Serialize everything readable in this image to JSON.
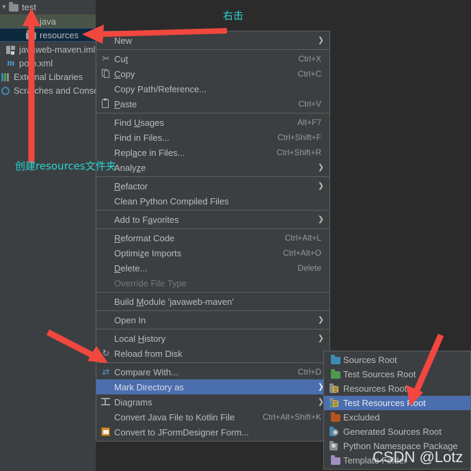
{
  "tree": {
    "rows": [
      {
        "label": "test",
        "icon": "folder-gray-icon",
        "indent": 16,
        "chevron": "v",
        "state": "normal"
      },
      {
        "label": "java",
        "icon": "folder-source-icon",
        "indent": 38,
        "chevron": "",
        "state": "hover"
      },
      {
        "label": "resources",
        "icon": "folder-plain-icon",
        "indent": 38,
        "chevron": "",
        "state": "selected"
      },
      {
        "label": "javaweb-maven.iml",
        "icon": "iml-file-icon",
        "indent": 8,
        "chevron": "",
        "state": "normal"
      },
      {
        "label": "pom.xml",
        "icon": "maven-pom-icon",
        "indent": 8,
        "chevron": "",
        "state": "normal"
      },
      {
        "label": "External Libraries",
        "icon": "libraries-icon",
        "indent": 0,
        "chevron": "",
        "state": "normal"
      },
      {
        "label": "Scratches and Consoles",
        "icon": "scratches-icon",
        "indent": 0,
        "chevron": "",
        "state": "normal"
      }
    ]
  },
  "context_menu": {
    "items": [
      {
        "type": "item",
        "label": "New",
        "pre": "",
        "uk": "",
        "post": "",
        "shortcut": "",
        "icon": "",
        "arrow": true
      },
      {
        "type": "sep"
      },
      {
        "type": "item",
        "label": "Cut",
        "pre": "Cu",
        "uk": "t",
        "post": "",
        "shortcut": "Ctrl+X",
        "icon": "scissors-icon",
        "arrow": false
      },
      {
        "type": "item",
        "label": "Copy",
        "pre": "",
        "uk": "C",
        "post": "opy",
        "shortcut": "Ctrl+C",
        "icon": "copy-icon",
        "arrow": false
      },
      {
        "type": "item",
        "label": "Copy Path/Reference...",
        "pre": "Copy Path/Reference...",
        "uk": "",
        "post": "",
        "shortcut": "",
        "icon": "",
        "arrow": false
      },
      {
        "type": "item",
        "label": "Paste",
        "pre": "",
        "uk": "P",
        "post": "aste",
        "shortcut": "Ctrl+V",
        "icon": "paste-icon",
        "arrow": false
      },
      {
        "type": "sep"
      },
      {
        "type": "item",
        "label": "Find Usages",
        "pre": "Find ",
        "uk": "U",
        "post": "sages",
        "shortcut": "Alt+F7",
        "icon": "",
        "arrow": false
      },
      {
        "type": "item",
        "label": "Find in Files...",
        "pre": "Find in Files...",
        "uk": "",
        "post": "",
        "shortcut": "Ctrl+Shift+F",
        "icon": "",
        "arrow": false
      },
      {
        "type": "item",
        "label": "Replace in Files...",
        "pre": "Repl",
        "uk": "a",
        "post": "ce in Files...",
        "shortcut": "Ctrl+Shift+R",
        "icon": "",
        "arrow": false
      },
      {
        "type": "item",
        "label": "Analyze",
        "pre": "Analy",
        "uk": "z",
        "post": "e",
        "shortcut": "",
        "icon": "",
        "arrow": true
      },
      {
        "type": "sep"
      },
      {
        "type": "item",
        "label": "Refactor",
        "pre": "",
        "uk": "R",
        "post": "efactor",
        "shortcut": "",
        "icon": "",
        "arrow": true
      },
      {
        "type": "item",
        "label": "Clean Python Compiled Files",
        "pre": "Clean Python Compiled Files",
        "uk": "",
        "post": "",
        "shortcut": "",
        "icon": "",
        "arrow": false
      },
      {
        "type": "sep"
      },
      {
        "type": "item",
        "label": "Add to Favorites",
        "pre": "Add to F",
        "uk": "a",
        "post": "vorites",
        "shortcut": "",
        "icon": "",
        "arrow": true
      },
      {
        "type": "sep"
      },
      {
        "type": "item",
        "label": "Reformat Code",
        "pre": "",
        "uk": "R",
        "post": "eformat Code",
        "shortcut": "Ctrl+Alt+L",
        "icon": "",
        "arrow": false
      },
      {
        "type": "item",
        "label": "Optimize Imports",
        "pre": "Optimi",
        "uk": "z",
        "post": "e Imports",
        "shortcut": "Ctrl+Alt+O",
        "icon": "",
        "arrow": false
      },
      {
        "type": "item",
        "label": "Delete...",
        "pre": "",
        "uk": "D",
        "post": "elete...",
        "shortcut": "Delete",
        "icon": "",
        "arrow": false
      },
      {
        "type": "item",
        "label": "Override File Type",
        "pre": "Override File Type",
        "uk": "",
        "post": "",
        "shortcut": "",
        "icon": "",
        "arrow": false,
        "disabled": true
      },
      {
        "type": "sep"
      },
      {
        "type": "item",
        "label": "Build Module 'javaweb-maven'",
        "pre": "Build ",
        "uk": "M",
        "post": "odule 'javaweb-maven'",
        "shortcut": "",
        "icon": "",
        "arrow": false
      },
      {
        "type": "sep"
      },
      {
        "type": "item",
        "label": "Open In",
        "pre": "Open In",
        "uk": "",
        "post": "",
        "shortcut": "",
        "icon": "",
        "arrow": true
      },
      {
        "type": "sep"
      },
      {
        "type": "item",
        "label": "Local History",
        "pre": "Local ",
        "uk": "H",
        "post": "istory",
        "shortcut": "",
        "icon": "",
        "arrow": true
      },
      {
        "type": "item",
        "label": "Reload from Disk",
        "pre": "Reload from Disk",
        "uk": "",
        "post": "",
        "shortcut": "",
        "icon": "reload-icon",
        "arrow": false
      },
      {
        "type": "sep"
      },
      {
        "type": "item",
        "label": "Compare With...",
        "pre": "Compare With...",
        "uk": "",
        "post": "",
        "shortcut": "Ctrl+D",
        "icon": "compare-icon",
        "arrow": false
      },
      {
        "type": "item",
        "label": "Mark Directory as",
        "pre": "Mark Directory as",
        "uk": "",
        "post": "",
        "shortcut": "",
        "icon": "",
        "arrow": true,
        "selected": true
      },
      {
        "type": "item",
        "label": "Diagrams",
        "pre": "Diagrams",
        "uk": "",
        "post": "",
        "shortcut": "",
        "icon": "diagrams-icon",
        "arrow": true
      },
      {
        "type": "item",
        "label": "Convert Java File to Kotlin File",
        "pre": "Convert Java File to Kotlin File",
        "uk": "",
        "post": "",
        "shortcut": "Ctrl+Alt+Shift+K",
        "icon": "",
        "arrow": false
      },
      {
        "type": "item",
        "label": "Convert to JFormDesigner Form...",
        "pre": "Convert to JFormDesigner Form...",
        "uk": "",
        "post": "",
        "shortcut": "",
        "icon": "jformdesigner-icon",
        "arrow": false
      }
    ]
  },
  "submenu": {
    "items": [
      {
        "label": "Sources Root",
        "icon": "folder-blue-icon",
        "selected": false
      },
      {
        "label": "Test Sources Root",
        "icon": "folder-green-icon",
        "selected": false
      },
      {
        "label": "Resources Root",
        "icon": "folder-resources-icon",
        "selected": false
      },
      {
        "label": "Test Resources Root",
        "icon": "folder-test-resources-icon",
        "selected": true
      },
      {
        "label": "Excluded",
        "icon": "folder-orange-icon",
        "selected": false
      },
      {
        "label": "Generated Sources Root",
        "icon": "folder-generated-icon",
        "selected": false
      },
      {
        "label": "Python Namespace Package",
        "icon": "folder-namespace-icon",
        "selected": false
      },
      {
        "label": "Template Folder",
        "icon": "folder-purple-icon",
        "selected": false
      }
    ]
  },
  "annotations": {
    "right_click": "右击",
    "create_resources": "创建resources文件夹",
    "watermark": "CSDN @Lotz",
    "arrow_color": "#f2473f",
    "text_color": "#2ad6d6"
  }
}
